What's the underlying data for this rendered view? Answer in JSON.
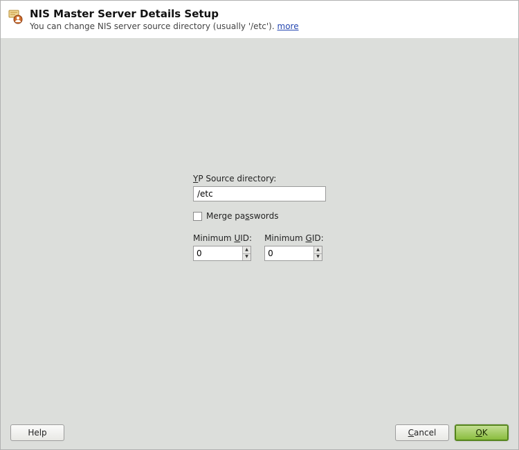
{
  "header": {
    "title": "NIS Master Server Details Setup",
    "subtitle_text": "You can change NIS server source directory (usually '/etc').",
    "more_label": "more"
  },
  "form": {
    "yp_label_prefix": "Y",
    "yp_label_rest": "P Source directory:",
    "yp_value": "/etc",
    "merge_label_prefix": "Merge pa",
    "merge_label_underlined": "s",
    "merge_label_suffix": "swords",
    "merge_checked": false,
    "min_uid_prefix": "Minimum ",
    "min_uid_underlined": "U",
    "min_uid_suffix": "ID:",
    "min_uid_value": "0",
    "min_gid_prefix": "Minimum ",
    "min_gid_underlined": "G",
    "min_gid_suffix": "ID:",
    "min_gid_value": "0"
  },
  "buttons": {
    "help": "Help",
    "cancel_underlined": "C",
    "cancel_rest": "ancel",
    "ok_underlined": "O",
    "ok_rest": "K"
  }
}
